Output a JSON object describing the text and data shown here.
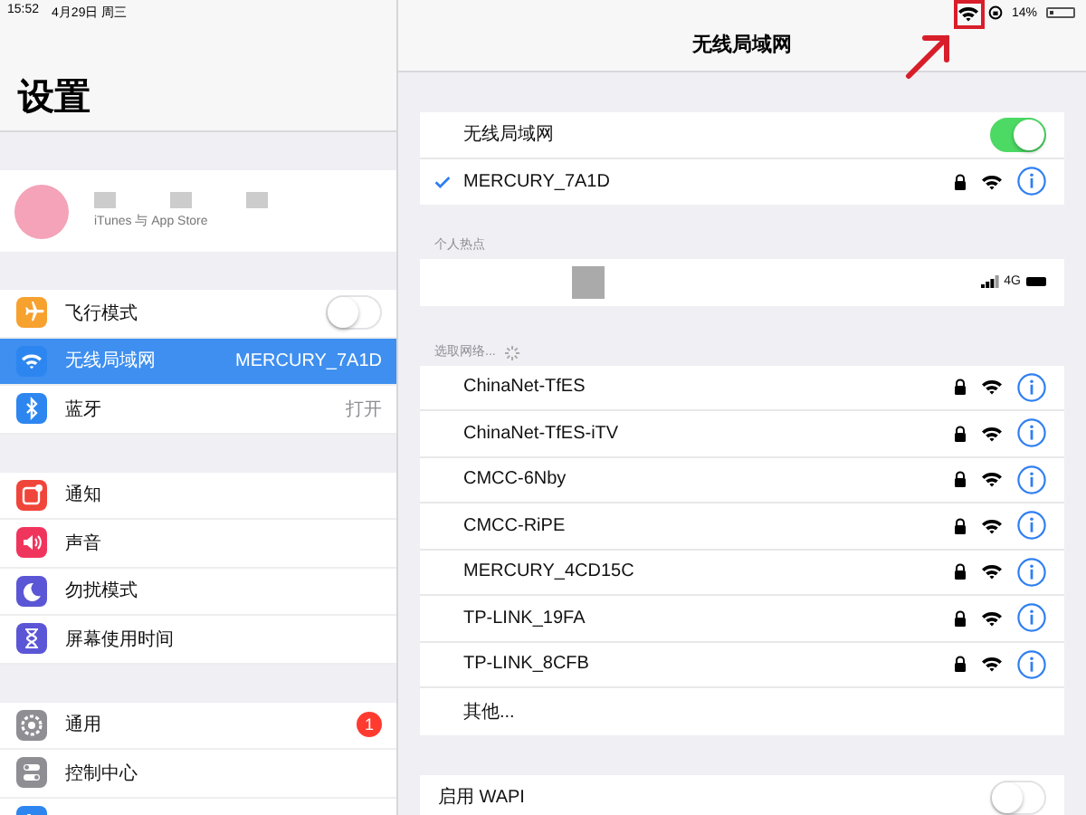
{
  "status_bar": {
    "time": "15:52",
    "date": "4月29日 周三",
    "battery": "14%"
  },
  "sidebar": {
    "title": "设置",
    "account": {
      "subtitle": "iTunes 与 App Store"
    },
    "groups": [
      [
        {
          "label": "飞行模式",
          "color": "#f7a12f",
          "kind": "toggle",
          "on": false,
          "selected": false
        },
        {
          "label": "无线局域网",
          "color": "#2d86f0",
          "kind": "value",
          "value": "MERCURY_7A1D",
          "selected": true
        },
        {
          "label": "蓝牙",
          "color": "#2d86f0",
          "kind": "value",
          "value": "打开",
          "selected": false
        }
      ],
      [
        {
          "label": "通知",
          "color": "#f0453a",
          "kind": "plain",
          "selected": false
        },
        {
          "label": "声音",
          "color": "#f0355d",
          "kind": "plain",
          "selected": false
        },
        {
          "label": "勿扰模式",
          "color": "#5b56d6",
          "kind": "plain",
          "selected": false
        },
        {
          "label": "屏幕使用时间",
          "color": "#5b56d6",
          "kind": "plain",
          "selected": false
        }
      ],
      [
        {
          "label": "通用",
          "color": "#8e8e93",
          "kind": "badge",
          "badge": "1",
          "selected": false
        },
        {
          "label": "控制中心",
          "color": "#8e8e93",
          "kind": "plain",
          "selected": false
        },
        {
          "color": "#2d86f0",
          "kind": "plain",
          "selected": false
        }
      ]
    ]
  },
  "wifi": {
    "title": "无线局域网",
    "toggle": {
      "label": "无线局域网",
      "on": true
    },
    "current": {
      "name": "MERCURY_7A1D",
      "connected": true
    },
    "hotspot_header": "个人热点",
    "hotspot": {
      "network": "4G"
    },
    "choose_header": "选取网络...",
    "networks": [
      {
        "name": "ChinaNet-TfES",
        "locked": true
      },
      {
        "name": "ChinaNet-TfES-iTV",
        "locked": true
      },
      {
        "name": "CMCC-6Nby",
        "locked": true
      },
      {
        "name": "CMCC-RiPE",
        "locked": true
      },
      {
        "name": "MERCURY_4CD15C",
        "locked": true
      },
      {
        "name": "TP-LINK_19FA",
        "locked": true
      },
      {
        "name": "TP-LINK_8CFB",
        "locked": true
      }
    ],
    "other": "其他...",
    "wapi": {
      "label": "启用 WAPI",
      "on": false
    }
  }
}
